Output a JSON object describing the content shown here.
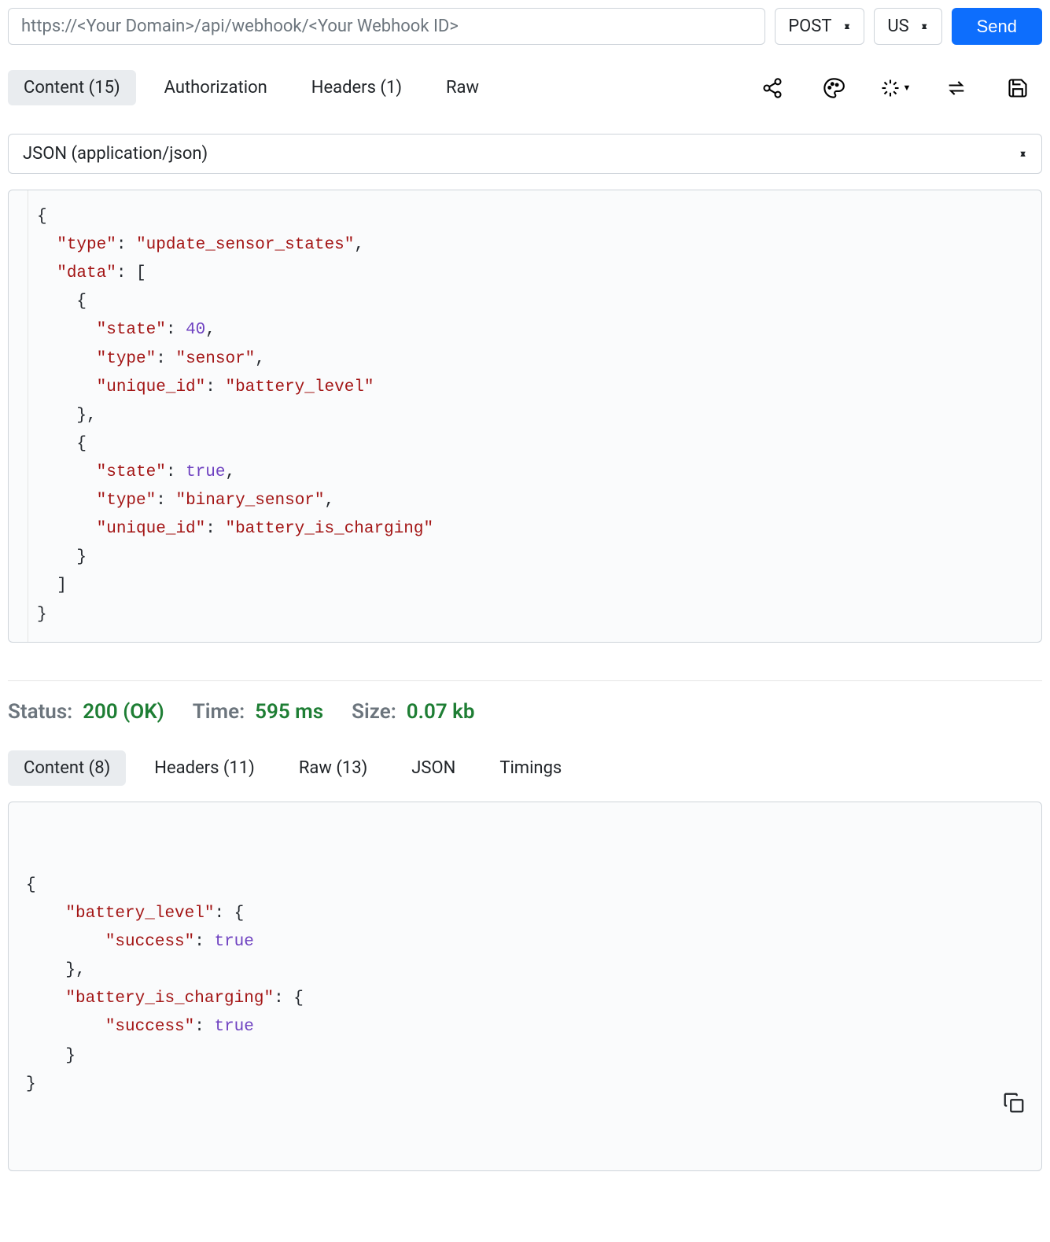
{
  "request": {
    "url_placeholder": "https://<Your Domain>/api/webhook/<Your Webhook ID>",
    "method": "POST",
    "region": "US",
    "send_label": "Send"
  },
  "req_tabs": {
    "content": "Content (15)",
    "authorization": "Authorization",
    "headers": "Headers (1)",
    "raw": "Raw"
  },
  "content_type": "JSON (application/json)",
  "request_body_tokens": [
    [
      "punc",
      "{\n"
    ],
    [
      "punc",
      "  "
    ],
    [
      "key",
      "\"type\""
    ],
    [
      "punc",
      ": "
    ],
    [
      "str",
      "\"update_sensor_states\""
    ],
    [
      "punc",
      ",\n"
    ],
    [
      "punc",
      "  "
    ],
    [
      "key",
      "\"data\""
    ],
    [
      "punc",
      ": [\n"
    ],
    [
      "punc",
      "    {\n"
    ],
    [
      "punc",
      "      "
    ],
    [
      "key",
      "\"state\""
    ],
    [
      "punc",
      ": "
    ],
    [
      "num",
      "40"
    ],
    [
      "punc",
      ",\n"
    ],
    [
      "punc",
      "      "
    ],
    [
      "key",
      "\"type\""
    ],
    [
      "punc",
      ": "
    ],
    [
      "str",
      "\"sensor\""
    ],
    [
      "punc",
      ",\n"
    ],
    [
      "punc",
      "      "
    ],
    [
      "key",
      "\"unique_id\""
    ],
    [
      "punc",
      ": "
    ],
    [
      "str",
      "\"battery_level\""
    ],
    [
      "punc",
      "\n"
    ],
    [
      "punc",
      "    },\n"
    ],
    [
      "punc",
      "    {\n"
    ],
    [
      "punc",
      "      "
    ],
    [
      "key",
      "\"state\""
    ],
    [
      "punc",
      ": "
    ],
    [
      "bool",
      "true"
    ],
    [
      "punc",
      ",\n"
    ],
    [
      "punc",
      "      "
    ],
    [
      "key",
      "\"type\""
    ],
    [
      "punc",
      ": "
    ],
    [
      "str",
      "\"binary_sensor\""
    ],
    [
      "punc",
      ",\n"
    ],
    [
      "punc",
      "      "
    ],
    [
      "key",
      "\"unique_id\""
    ],
    [
      "punc",
      ": "
    ],
    [
      "str",
      "\"battery_is_charging\""
    ],
    [
      "punc",
      "\n"
    ],
    [
      "punc",
      "    }\n"
    ],
    [
      "punc",
      "  ]\n"
    ],
    [
      "punc",
      "}"
    ]
  ],
  "status": {
    "label": "Status:",
    "value": "200 (OK)",
    "time_label": "Time:",
    "time_value": "595 ms",
    "size_label": "Size:",
    "size_value": "0.07 kb"
  },
  "res_tabs": {
    "content": "Content (8)",
    "headers": "Headers (11)",
    "raw": "Raw (13)",
    "json": "JSON",
    "timings": "Timings"
  },
  "response_body_tokens": [
    [
      "punc",
      "{\n"
    ],
    [
      "punc",
      "    "
    ],
    [
      "key",
      "\"battery_level\""
    ],
    [
      "punc",
      ": {\n"
    ],
    [
      "punc",
      "        "
    ],
    [
      "key",
      "\"success\""
    ],
    [
      "punc",
      ": "
    ],
    [
      "bool",
      "true"
    ],
    [
      "punc",
      "\n"
    ],
    [
      "punc",
      "    },\n"
    ],
    [
      "punc",
      "    "
    ],
    [
      "key",
      "\"battery_is_charging\""
    ],
    [
      "punc",
      ": {\n"
    ],
    [
      "punc",
      "        "
    ],
    [
      "key",
      "\"success\""
    ],
    [
      "punc",
      ": "
    ],
    [
      "bool",
      "true"
    ],
    [
      "punc",
      "\n"
    ],
    [
      "punc",
      "    }\n"
    ],
    [
      "punc",
      "}"
    ]
  ]
}
